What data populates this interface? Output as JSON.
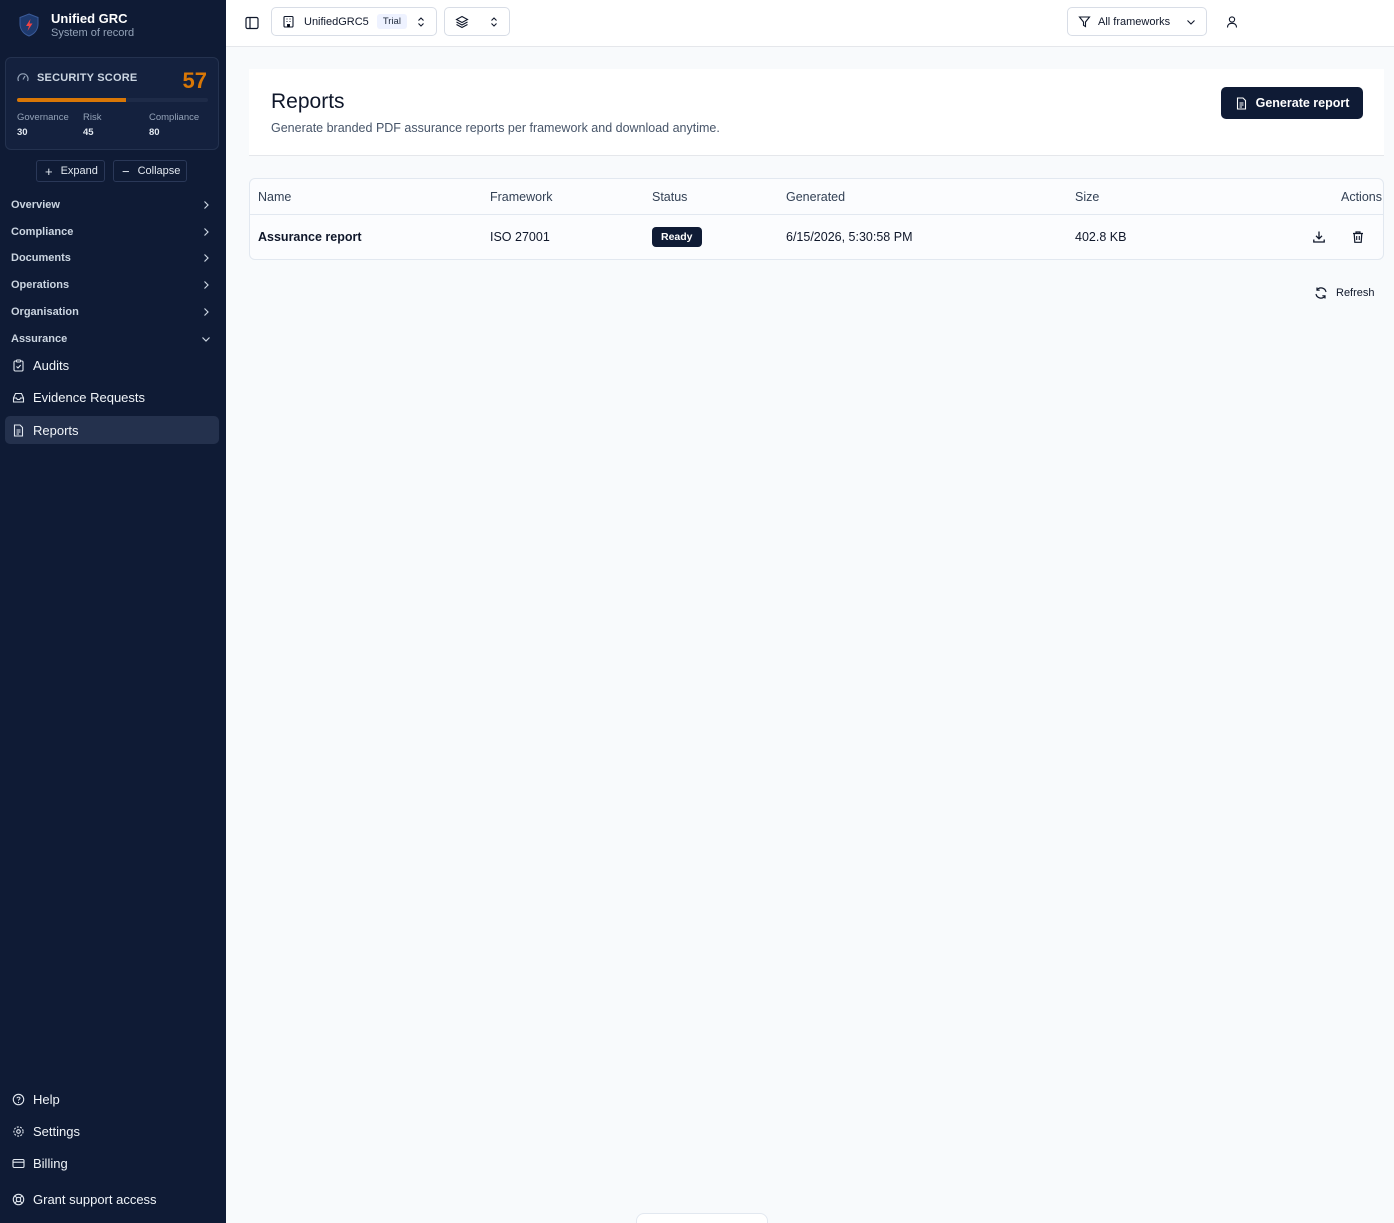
{
  "brand": {
    "title": "Unified GRC",
    "subtitle": "System of record"
  },
  "score": {
    "label": "SECURITY SCORE",
    "value": "57",
    "progress_percent": 57,
    "accent": "#d97706",
    "metrics": [
      {
        "label": "Governance",
        "value": "30"
      },
      {
        "label": "Risk",
        "value": "45"
      },
      {
        "label": "Compliance",
        "value": "80"
      }
    ]
  },
  "tree_controls": {
    "expand": "Expand",
    "collapse": "Collapse"
  },
  "nav": {
    "groups": [
      {
        "label": "Overview",
        "icon": "chevron-right-icon"
      },
      {
        "label": "Compliance",
        "icon": "chevron-right-icon"
      },
      {
        "label": "Documents",
        "icon": "chevron-right-icon"
      },
      {
        "label": "Operations",
        "icon": "chevron-right-icon"
      },
      {
        "label": "Organisation",
        "icon": "chevron-right-icon"
      },
      {
        "label": "Assurance",
        "icon": "chevron-down-icon"
      }
    ],
    "items": [
      {
        "label": "Audits",
        "icon": "clipboard-check-icon"
      },
      {
        "label": "Evidence Requests",
        "icon": "inbox-icon"
      },
      {
        "label": "Reports",
        "icon": "file-text-icon",
        "active": true
      }
    ],
    "footer": [
      {
        "label": "Help",
        "icon": "help-circle-icon"
      },
      {
        "label": "Settings",
        "icon": "gear-icon"
      },
      {
        "label": "Billing",
        "icon": "credit-card-icon"
      },
      {
        "label": "Grant support access",
        "icon": "life-buoy-icon"
      }
    ]
  },
  "topbar": {
    "org_name": "UnifiedGRC5",
    "org_badge": "Trial",
    "framework_filter": "All frameworks"
  },
  "page": {
    "title": "Reports",
    "subtitle": "Generate branded PDF assurance reports per framework and download anytime.",
    "primary_action": "Generate report"
  },
  "table": {
    "columns": [
      "Name",
      "Framework",
      "Status",
      "Generated",
      "Size",
      "Actions"
    ],
    "rows": [
      {
        "name": "Assurance report",
        "framework": "ISO 27001",
        "status": "Ready",
        "generated": "6/15/2026, 5:30:58 PM",
        "size": "402.8 KB"
      }
    ]
  },
  "refresh_label": "Refresh"
}
